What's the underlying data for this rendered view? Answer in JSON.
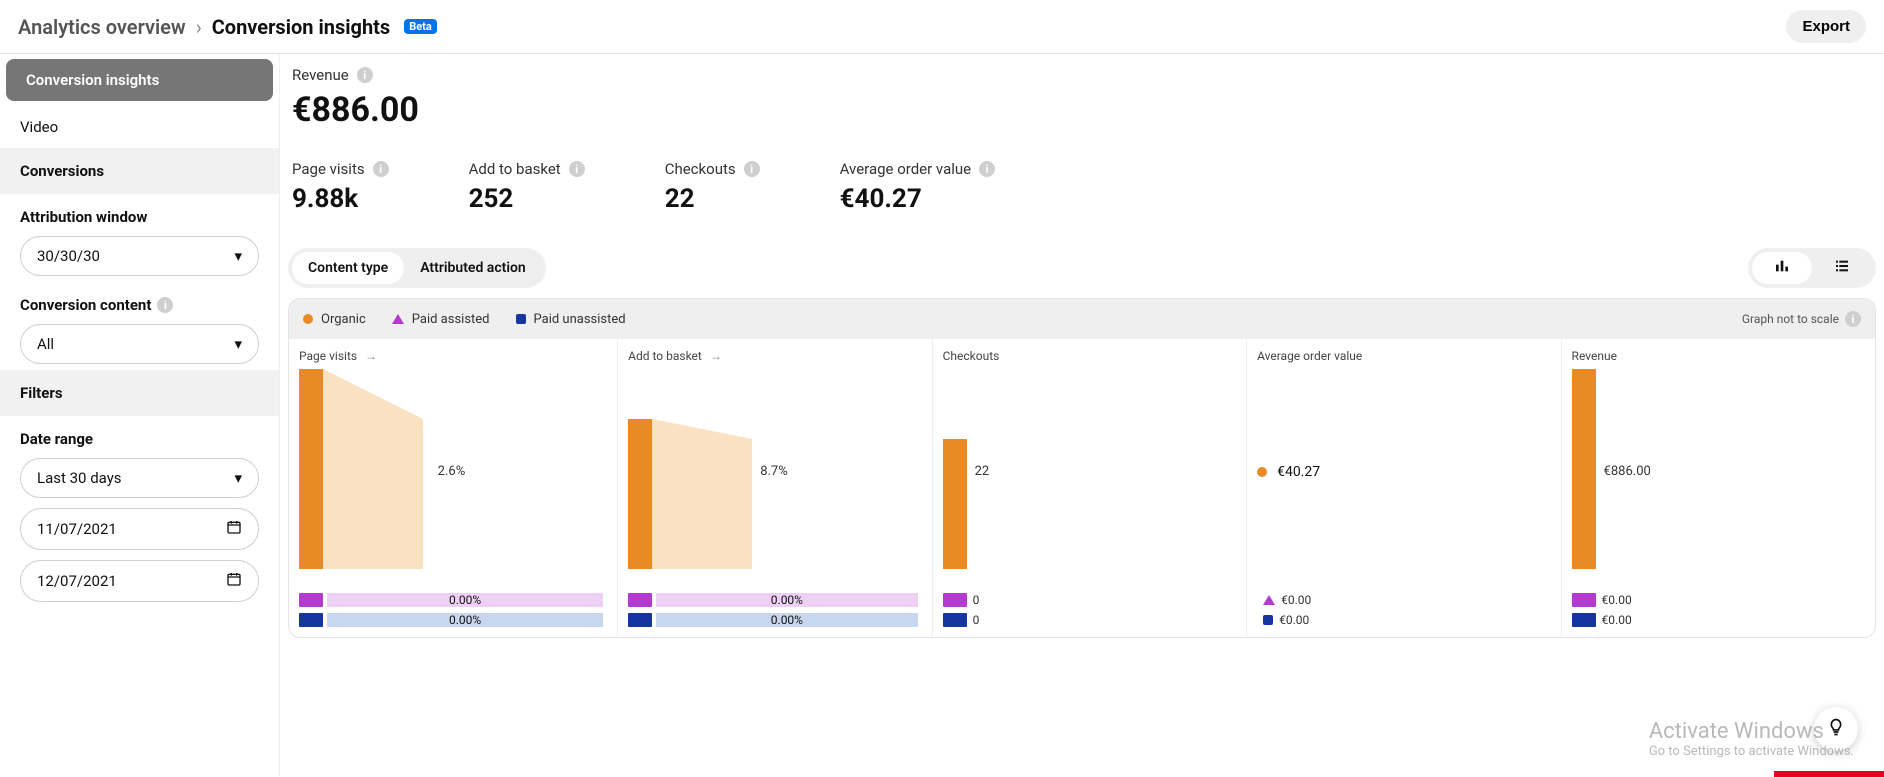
{
  "breadcrumb": {
    "root": "Analytics overview",
    "current": "Conversion insights",
    "badge": "Beta"
  },
  "export_label": "Export",
  "sidebar": {
    "tabs": [
      {
        "label": "Conversion insights",
        "active": true
      },
      {
        "label": "Video",
        "active": false
      }
    ],
    "sections": {
      "conversions": {
        "title": "Conversions",
        "attribution_label": "Attribution window",
        "attribution_value": "30/30/30",
        "content_label": "Conversion content",
        "content_value": "All"
      },
      "filters": {
        "title": "Filters",
        "date_range_label": "Date range",
        "date_range_value": "Last 30 days",
        "date_from": "11/07/2021",
        "date_to": "12/07/2021"
      }
    }
  },
  "metrics": {
    "revenue": {
      "label": "Revenue",
      "value": "€886.00"
    },
    "row": [
      {
        "label": "Page visits",
        "value": "9.88k"
      },
      {
        "label": "Add to basket",
        "value": "252"
      },
      {
        "label": "Checkouts",
        "value": "22"
      },
      {
        "label": "Average order value",
        "value": "€40.27"
      }
    ]
  },
  "chart_tabs": {
    "a": "Content type",
    "b": "Attributed action"
  },
  "legend": {
    "organic": "Organic",
    "paid_assisted": "Paid assisted",
    "paid_unassisted": "Paid unassisted"
  },
  "graph_note": "Graph not to scale",
  "colors": {
    "organic": "#e98a24",
    "organic_light": "#f9e1c2",
    "paid_assisted": "#b33ccf",
    "paid_assisted_light": "#efd0f5",
    "paid_unassisted": "#15369e",
    "paid_unassisted_light": "#c9d6ef"
  },
  "chart_data": {
    "type": "funnel",
    "series": [
      "Organic",
      "Paid assisted",
      "Paid unassisted"
    ],
    "stages": [
      {
        "name": "Page visits",
        "has_arrow": true
      },
      {
        "name": "Add to basket",
        "has_arrow": true
      },
      {
        "name": "Checkouts",
        "has_arrow": false
      },
      {
        "name": "Average order value",
        "has_arrow": false
      },
      {
        "name": "Revenue",
        "has_arrow": false
      }
    ],
    "organic": {
      "bar_heights_rel": [
        1.0,
        0.75,
        0.65,
        0,
        1.0
      ],
      "transition_labels": [
        "2.6%",
        "8.7%"
      ],
      "stage_labels": {
        "checkouts": "22",
        "aov": "€40.27",
        "revenue": "€886.00"
      }
    },
    "paid_assisted": {
      "transition_labels": [
        "0.00%",
        "0.00%"
      ],
      "stage_labels": {
        "checkouts": "0",
        "aov": "€0.00",
        "revenue": "€0.00"
      }
    },
    "paid_unassisted": {
      "transition_labels": [
        "0.00%",
        "0.00%"
      ],
      "stage_labels": {
        "checkouts": "0",
        "aov": "€0.00",
        "revenue": "€0.00"
      }
    }
  },
  "watermark": {
    "line1": "Activate Windows",
    "line2": "Go to Settings to activate Windows."
  }
}
